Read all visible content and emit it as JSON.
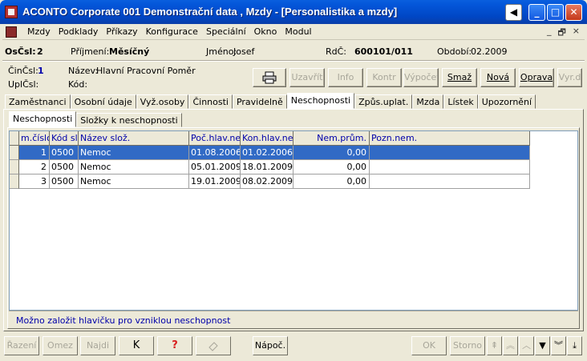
{
  "window": {
    "title": "ACONTO Corporate 001 Demonstrační data , Mzdy - [Personalistika a mzdy]",
    "controls": {
      "nav": "◀",
      "minimize": "_",
      "maximize": "□",
      "close": "✕"
    }
  },
  "menu": {
    "items": [
      "Mzdy",
      "Podklady",
      "Příkazy",
      "Konfigurace",
      "Speciální",
      "Okno",
      "Modul"
    ],
    "mdi": [
      "_",
      "🗗",
      "×"
    ]
  },
  "header": {
    "oscsl_label": "OsČsl:",
    "oscsl_value": "2",
    "prijmeni_label": "Příjmení:",
    "prijmeni_value": "Měsíčný",
    "jmeno_label": "Jméno:",
    "jmeno_value": "Josef",
    "rdc_label": "RdČ:",
    "rdc_value": "600101/011",
    "obdobi_label": "Období:",
    "obdobi_value": "02.2009",
    "cincsl_label": "ČinČsl:",
    "cincsl_value": "1",
    "nazev_label": "Název:",
    "nazev_value": "Hlavní Pracovní Poměr",
    "uplcsl_label": "UplČsl:",
    "kod_label": "Kód:"
  },
  "toolbar": {
    "uzavrit": "Uzavřít",
    "info": "Info",
    "kontr": "Kontr",
    "vypocet": "Výpočet",
    "smaz": "Smaž",
    "nova": "Nová",
    "oprava": "Oprava",
    "vyrd": "Vyr.d"
  },
  "tabs": [
    "Zaměstnanci",
    "Osobní údaje",
    "Vyž.osoby",
    "Činnosti",
    "Pravidelně",
    "Neschopnosti",
    "Způs.uplat.",
    "Mzda",
    "Lístek",
    "Upozornění"
  ],
  "active_tab": "Neschopnosti",
  "subtabs": [
    "Neschopnosti",
    "Složky k neschopnosti"
  ],
  "grid": {
    "columns": [
      "m.číslo",
      "Kód slo",
      "Název slož.",
      "Poč.hlav.nem",
      "Kon.hlav.nem",
      "Nem.prům.",
      "Pozn.nem."
    ],
    "rows": [
      {
        "cislo": "1",
        "kod": "0500",
        "nazev": "Nemoc",
        "poc": "01.08.2006",
        "kon": "01.02.2006",
        "prum": "0,00",
        "pozn": ""
      },
      {
        "cislo": "2",
        "kod": "0500",
        "nazev": "Nemoc",
        "poc": "05.01.2009",
        "kon": "18.01.2009",
        "prum": "0,00",
        "pozn": ""
      },
      {
        "cislo": "3",
        "kod": "0500",
        "nazev": "Nemoc",
        "poc": "19.01.2009",
        "kon": "08.02.2009",
        "prum": "0,00",
        "pozn": ""
      }
    ]
  },
  "hint": "Možno založit hlavičku pro vzniklou neschopnost",
  "bottom": {
    "razeni": "Řazení",
    "omez": "Omez",
    "najdi": "Najdi",
    "k": "K",
    "help": "?",
    "napoc": "Nápoč.",
    "ok": "OK",
    "storno": "Storno"
  }
}
